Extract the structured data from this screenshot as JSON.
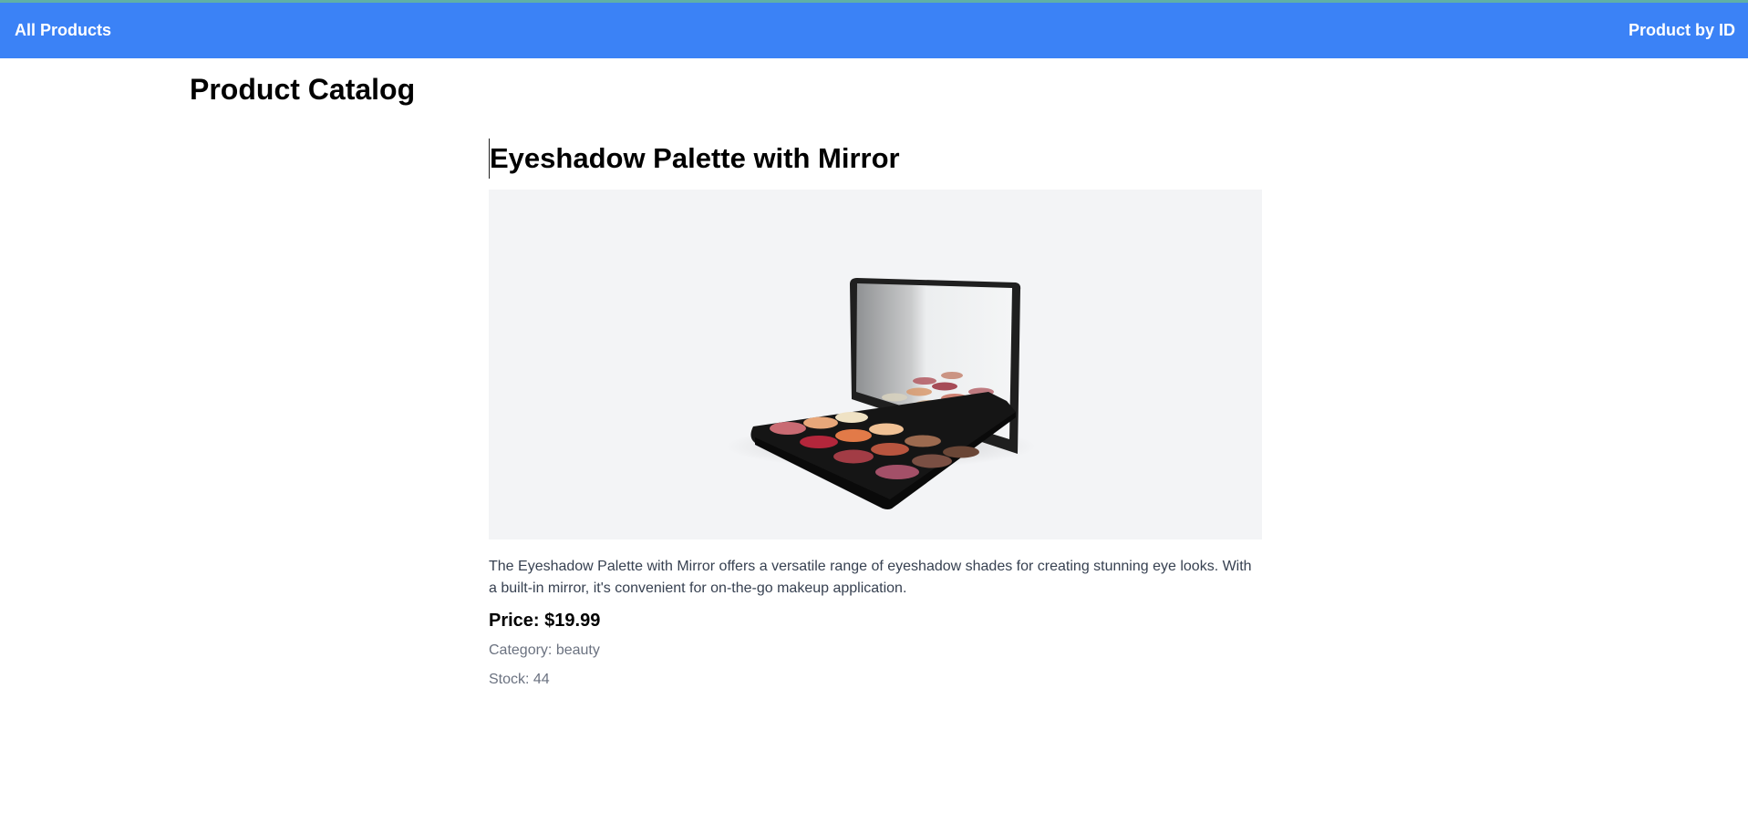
{
  "nav": {
    "all_products": "All Products",
    "product_by_id": "Product by ID"
  },
  "page": {
    "title": "Product Catalog"
  },
  "product": {
    "name": "Eyeshadow Palette with Mirror",
    "image_alt": "Eyeshadow Palette with Mirror",
    "description": "The Eyeshadow Palette with Mirror offers a versatile range of eyeshadow shades for creating stunning eye looks. With a built-in mirror, it's convenient for on-the-go makeup application.",
    "price": "Price: $19.99",
    "category": "Category: beauty",
    "stock": "Stock: 44"
  },
  "colors": {
    "navbar": "#3b82f6",
    "image_bg": "#f3f4f6"
  }
}
